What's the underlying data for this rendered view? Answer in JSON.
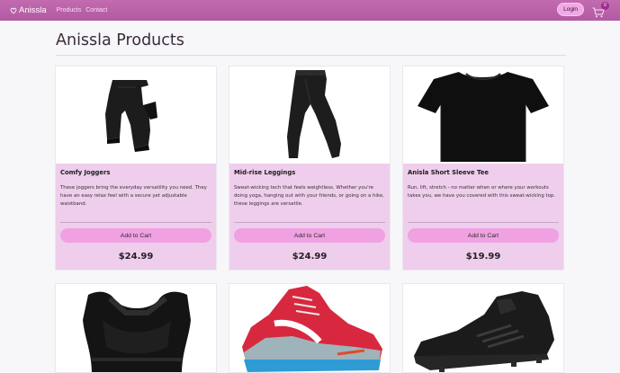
{
  "navbar": {
    "brand": "Anissla",
    "links": [
      "Products",
      "Contact"
    ],
    "login_label": "Login",
    "cart_count": "0",
    "colors": {
      "bar": "#b85fa8",
      "button": "#f2a8e6",
      "badge": "#a02d8e"
    }
  },
  "page": {
    "title": "Anissla Products"
  },
  "products": [
    {
      "name": "Comfy Joggers",
      "description": "These joggers bring the everyday versatility you need. They have an easy relax feel with a secure yet adjustable waistband.",
      "add_label": "Add to Cart",
      "price": "$24.99",
      "image": "joggers-image"
    },
    {
      "name": "Mid-rise Leggings",
      "description": "Sweat-wicking tech that feels weightless. Whether you're doing yoga, hanging out with your friends, or going on a hike, these leggings are versatile.",
      "add_label": "Add to Cart",
      "price": "$24.99",
      "image": "leggings-image"
    },
    {
      "name": "Anisla Short Sleeve Tee",
      "description": "Run, lift, stretch - no matter when or where your workouts takes you, we have you covered with this sweat-wicking top.",
      "add_label": "Add to Cart",
      "price": "$19.99",
      "image": "tee-image"
    }
  ],
  "lower_products": [
    {
      "image": "sports-bra-image"
    },
    {
      "image": "running-shoe-image"
    },
    {
      "image": "cleat-image"
    }
  ]
}
